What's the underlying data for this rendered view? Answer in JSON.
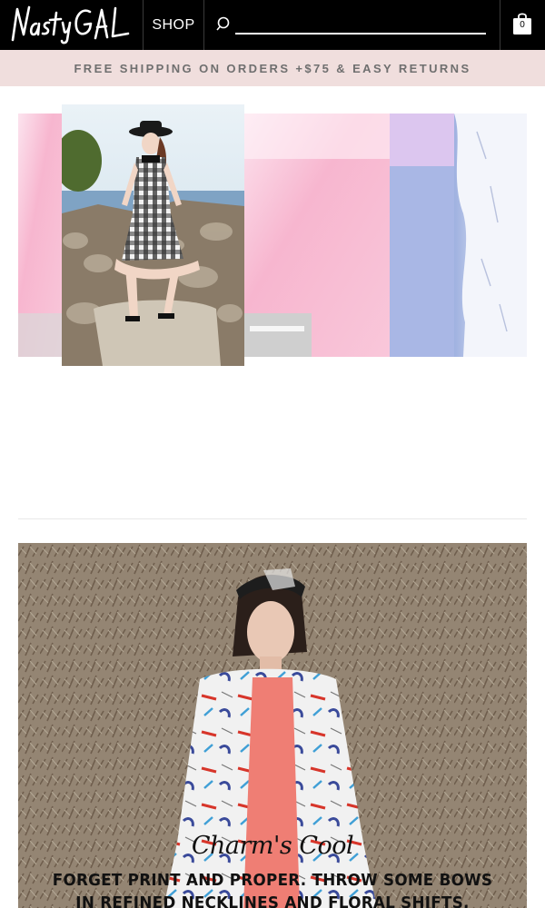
{
  "header": {
    "logo_text": "Nasty Gal",
    "shop_label": "SHOP",
    "search_placeholder": "",
    "cart_count": "0"
  },
  "promo": {
    "text": "FREE SHIPPING ON ORDERS +$75 & EASY RETURNS"
  },
  "hero": {
    "icons": [
      "beach-collage-image",
      "model-photo"
    ]
  },
  "editorial": {
    "title": "Charm's Cool",
    "copy": "FORGET PRINT AND PROPER. THROW SOME BOWS IN REFINED NECKLINES AND FLORAL SHIFTS."
  },
  "colors": {
    "header_bg": "#000000",
    "promo_bg": "#f0dedd",
    "promo_text": "#6f6f6f"
  }
}
